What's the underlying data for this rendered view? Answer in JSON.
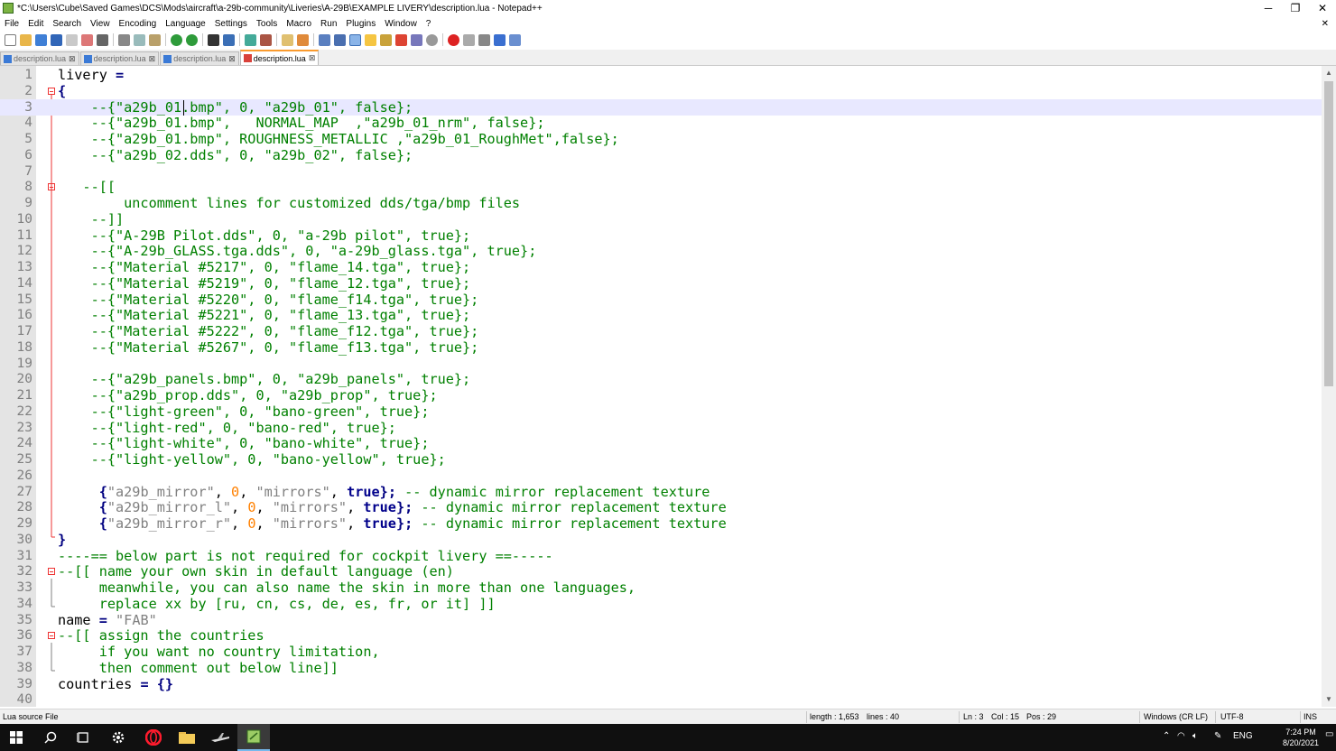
{
  "window": {
    "title": "*C:\\Users\\Cube\\Saved Games\\DCS\\Mods\\aircraft\\a-29b-community\\Liveries\\A-29B\\EXAMPLE LIVERY\\description.lua - Notepad++",
    "minimize": "─",
    "restore": "❐",
    "close": "✕"
  },
  "menu": {
    "items": [
      "File",
      "Edit",
      "Search",
      "View",
      "Encoding",
      "Language",
      "Settings",
      "Tools",
      "Macro",
      "Run",
      "Plugins",
      "Window",
      "?"
    ],
    "close_x": "✕"
  },
  "tabs": [
    {
      "label": "description.lua",
      "active": false
    },
    {
      "label": "description.lua",
      "active": false
    },
    {
      "label": "description.lua",
      "active": false
    },
    {
      "label": "description.lua",
      "active": true
    }
  ],
  "editor": {
    "current_line": 3,
    "lines": [
      [
        [
          "livery ",
          "def"
        ],
        [
          "=",
          "op"
        ]
      ],
      [
        [
          "{",
          "op"
        ]
      ],
      [
        [
          "    --{\"a29b_01.bmp\", 0, \"a29b_01\", false};",
          "com"
        ]
      ],
      [
        [
          "    --{\"a29b_01.bmp\",   NORMAL_MAP  ,\"a29b_01_nrm\", false};",
          "com"
        ]
      ],
      [
        [
          "    --{\"a29b_01.bmp\", ROUGHNESS_METALLIC ,\"a29b_01_RoughMet\",false};",
          "com"
        ]
      ],
      [
        [
          "    --{\"a29b_02.dds\", 0, \"a29b_02\", false};",
          "com"
        ]
      ],
      [
        [
          "",
          "def"
        ]
      ],
      [
        [
          "   --[[",
          "com"
        ]
      ],
      [
        [
          "        uncomment lines for customized dds/tga/bmp files",
          "com"
        ]
      ],
      [
        [
          "    --]]",
          "com"
        ]
      ],
      [
        [
          "    --{\"A-29B Pilot.dds\", 0, \"a-29b pilot\", true};",
          "com"
        ]
      ],
      [
        [
          "    --{\"A-29b_GLASS.tga.dds\", 0, \"a-29b_glass.tga\", true};",
          "com"
        ]
      ],
      [
        [
          "    --{\"Material #5217\", 0, \"flame_14.tga\", true};",
          "com"
        ]
      ],
      [
        [
          "    --{\"Material #5219\", 0, \"flame_12.tga\", true};",
          "com"
        ]
      ],
      [
        [
          "    --{\"Material #5220\", 0, \"flame_f14.tga\", true};",
          "com"
        ]
      ],
      [
        [
          "    --{\"Material #5221\", 0, \"flame_13.tga\", true};",
          "com"
        ]
      ],
      [
        [
          "    --{\"Material #5222\", 0, \"flame_f12.tga\", true};",
          "com"
        ]
      ],
      [
        [
          "    --{\"Material #5267\", 0, \"flame_f13.tga\", true};",
          "com"
        ]
      ],
      [
        [
          "",
          "def"
        ]
      ],
      [
        [
          "    --{\"a29b_panels.bmp\", 0, \"a29b_panels\", true};",
          "com"
        ]
      ],
      [
        [
          "    --{\"a29b_prop.dds\", 0, \"a29b_prop\", true};",
          "com"
        ]
      ],
      [
        [
          "    --{\"light-green\", 0, \"bano-green\", true};",
          "com"
        ]
      ],
      [
        [
          "    --{\"light-red\", 0, \"bano-red\", true};",
          "com"
        ]
      ],
      [
        [
          "    --{\"light-white\", 0, \"bano-white\", true};",
          "com"
        ]
      ],
      [
        [
          "    --{\"light-yellow\", 0, \"bano-yellow\", true};",
          "com"
        ]
      ],
      [
        [
          "",
          "def"
        ]
      ],
      [
        [
          "     ",
          "def"
        ],
        [
          "{",
          "op"
        ],
        [
          "\"a29b_mirror\"",
          "str"
        ],
        [
          ", ",
          "def"
        ],
        [
          "0",
          "num"
        ],
        [
          ", ",
          "def"
        ],
        [
          "\"mirrors\"",
          "str"
        ],
        [
          ", ",
          "def"
        ],
        [
          "true",
          "kw"
        ],
        [
          "};",
          "op"
        ],
        [
          " -- dynamic mirror replacement texture",
          "com"
        ]
      ],
      [
        [
          "     ",
          "def"
        ],
        [
          "{",
          "op"
        ],
        [
          "\"a29b_mirror_l\"",
          "str"
        ],
        [
          ", ",
          "def"
        ],
        [
          "0",
          "num"
        ],
        [
          ", ",
          "def"
        ],
        [
          "\"mirrors\"",
          "str"
        ],
        [
          ", ",
          "def"
        ],
        [
          "true",
          "kw"
        ],
        [
          "};",
          "op"
        ],
        [
          " -- dynamic mirror replacement texture",
          "com"
        ]
      ],
      [
        [
          "     ",
          "def"
        ],
        [
          "{",
          "op"
        ],
        [
          "\"a29b_mirror_r\"",
          "str"
        ],
        [
          ", ",
          "def"
        ],
        [
          "0",
          "num"
        ],
        [
          ", ",
          "def"
        ],
        [
          "\"mirrors\"",
          "str"
        ],
        [
          ", ",
          "def"
        ],
        [
          "true",
          "kw"
        ],
        [
          "};",
          "op"
        ],
        [
          " -- dynamic mirror replacement texture",
          "com"
        ]
      ],
      [
        [
          "}",
          "op"
        ]
      ],
      [
        [
          "----== below part is not required for cockpit livery ==-----",
          "com"
        ]
      ],
      [
        [
          "--[[ name your own skin in default language (en)",
          "com"
        ]
      ],
      [
        [
          "     meanwhile, you can also name the skin in more than one languages,",
          "com"
        ]
      ],
      [
        [
          "     replace xx by [ru, cn, cs, de, es, fr, or it] ]]",
          "com"
        ]
      ],
      [
        [
          "name ",
          "def"
        ],
        [
          "=",
          "op"
        ],
        [
          " ",
          "def"
        ],
        [
          "\"FAB\"",
          "str"
        ]
      ],
      [
        [
          "--[[ assign the countries",
          "com"
        ]
      ],
      [
        [
          "     if you want no country limitation,",
          "com"
        ]
      ],
      [
        [
          "     then comment out below line]]",
          "com"
        ]
      ],
      [
        [
          "countries ",
          "def"
        ],
        [
          "= {}",
          "op"
        ]
      ],
      [
        [
          "",
          "def"
        ]
      ]
    ],
    "fold_lines": [
      2,
      8,
      32,
      36
    ]
  },
  "scrollbar": {
    "up": "▲",
    "down": "▼"
  },
  "status": {
    "file_type": "Lua source File",
    "length": "length : 1,653",
    "lines": "lines : 40",
    "ln": "Ln : 3",
    "col": "Col : 15",
    "pos": "Pos : 29",
    "eol": "Windows (CR LF)",
    "encoding": "UTF-8",
    "mode": "INS"
  },
  "taskbar": {
    "language": "ENG",
    "time": "7:24 PM",
    "date": "8/20/2021"
  },
  "colors": {
    "comment": "#008000",
    "string": "#808080",
    "number": "#ff8000",
    "keyword": "#00008b",
    "operator": "#000080"
  }
}
